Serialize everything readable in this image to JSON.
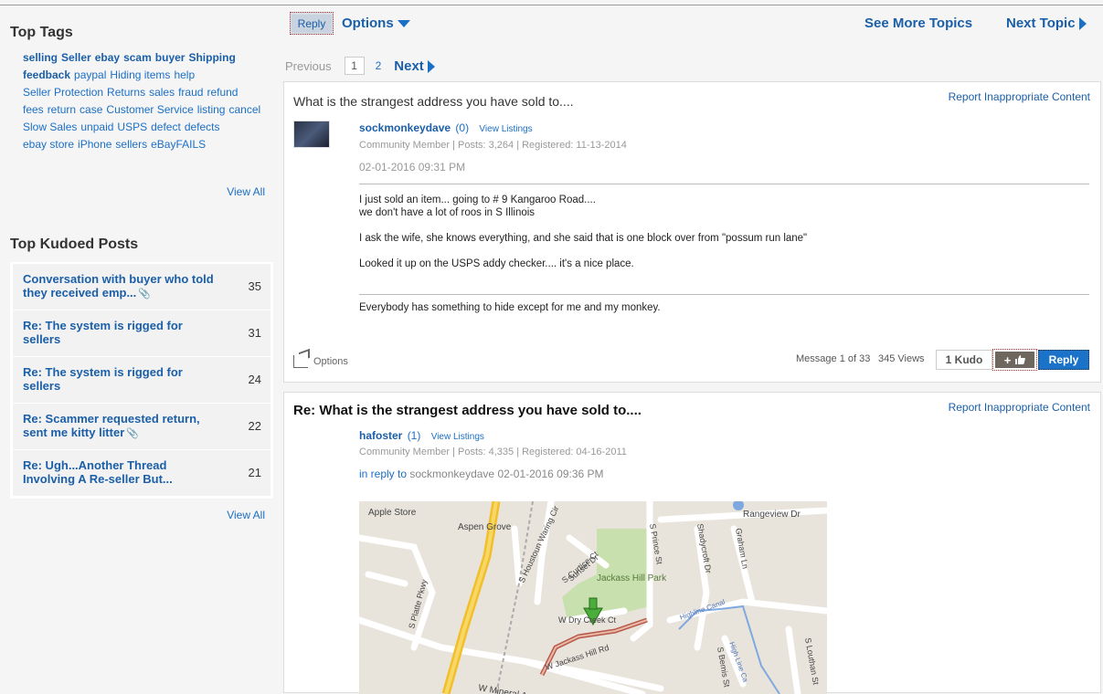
{
  "sidebar": {
    "top_tags_title": "Top Tags",
    "tags": [
      {
        "label": "selling",
        "bold": true
      },
      {
        "label": "Seller",
        "bold": true
      },
      {
        "label": "ebay",
        "bold": true
      },
      {
        "label": "scam",
        "bold": true
      },
      {
        "label": "buyer",
        "bold": true
      },
      {
        "label": "Shipping",
        "bold": true
      },
      {
        "label": "feedback",
        "bold": true
      },
      {
        "label": "paypal",
        "bold": false
      },
      {
        "label": "Hiding items",
        "bold": false
      },
      {
        "label": "help",
        "bold": false
      },
      {
        "label": "Seller Protection",
        "bold": false
      },
      {
        "label": "Returns",
        "bold": false
      },
      {
        "label": "sales",
        "bold": false
      },
      {
        "label": "fraud",
        "bold": false
      },
      {
        "label": "refund",
        "bold": false
      },
      {
        "label": "fees",
        "bold": false
      },
      {
        "label": "return",
        "bold": false
      },
      {
        "label": "case",
        "bold": false
      },
      {
        "label": "Customer Service",
        "bold": false
      },
      {
        "label": "listing",
        "bold": false
      },
      {
        "label": "cancel",
        "bold": false
      },
      {
        "label": "Slow Sales",
        "bold": false
      },
      {
        "label": "unpaid",
        "bold": false
      },
      {
        "label": "USPS",
        "bold": false
      },
      {
        "label": "defect",
        "bold": false
      },
      {
        "label": "defects",
        "bold": false
      },
      {
        "label": "ebay store",
        "bold": false
      },
      {
        "label": "iPhone",
        "bold": false
      },
      {
        "label": "sellers",
        "bold": false
      },
      {
        "label": "eBayFAILS",
        "bold": false
      }
    ],
    "tags_view_all": "View All",
    "top_kudoed_title": "Top Kudoed Posts",
    "kudoed_posts": [
      {
        "title": "Conversation with buyer who told they received emp...",
        "count": "35",
        "attachment": true
      },
      {
        "title": "Re: The system is rigged for sellers",
        "count": "31",
        "attachment": false
      },
      {
        "title": "Re: The system is rigged for sellers",
        "count": "24",
        "attachment": false
      },
      {
        "title": "Re: Scammer requested return, sent me kitty litter",
        "count": "22",
        "attachment": true
      },
      {
        "title": "Re: Ugh...Another Thread Involving A Re-seller But...",
        "count": "21",
        "attachment": false
      }
    ],
    "kudoed_view_all": "View All"
  },
  "toolbar": {
    "reply": "Reply",
    "options": "Options",
    "see_more": "See More Topics",
    "next_topic": "Next Topic"
  },
  "pager": {
    "previous": "Previous",
    "current": "1",
    "page2": "2",
    "next": "Next"
  },
  "post1": {
    "subject": "What is the strangest address you have sold to....",
    "report": "Report Inappropriate Content",
    "username": "sockmonkeydave",
    "kudos": "(0)",
    "view_listings": "View Listings",
    "meta": "Community Member | Posts: 3,264 | Registered: 11-13-2014",
    "date": "02-01-2016 09:31 PM",
    "body": [
      "I just sold an item... going to # 9 Kangaroo Road....",
      "we don't have a lot of roos in S Illinois",
      "I ask the wife, she knows everything, and she said that is one block over from \"possum run lane\"",
      "Looked it up on the USPS addy checker.... it's a nice place."
    ],
    "signature": "Everybody has something to hide except for me and my monkey.",
    "options": "Options",
    "message_count": "Message 1 of 33",
    "views": "345 Views",
    "kudo_count": "1 Kudo",
    "kudo_give": "+",
    "reply": "Reply"
  },
  "post2": {
    "subject": "Re: What is the strangest address you have sold to....",
    "report": "Report Inappropriate Content",
    "username": "hafoster",
    "kudos": "(1)",
    "view_listings": "View Listings",
    "meta": "Community Member | Posts: 4,335 | Registered: 04-16-2011",
    "in_reply": "in reply to",
    "in_reply_user": "sockmonkeydave",
    "in_reply_date": "02-01-2016 09:36 PM",
    "map_labels": {
      "apple_store": "Apple Store",
      "aspen_grove": "Aspen Grove",
      "rangeview": "Rangeview Dr",
      "park": "Jackass Hill Park",
      "platte": "S Platte Pkwy",
      "houstoun": "S Houstoun Waring Cir",
      "curtice": "S Curtice Ct",
      "sunset": "Sunset Dr",
      "prince": "S Prince St",
      "shadycroft": "Shadycroft Dr",
      "graham": "Graham Ln",
      "dry_creek": "W Dry Creek Ct",
      "jackass_hill": "W Jackass Hill Rd",
      "mineral": "W Mineral Ave",
      "canal": "Highline Canal",
      "high_line": "High Line Ca",
      "bemis": "S Bemis St",
      "louthan": "S Louthan St"
    }
  }
}
